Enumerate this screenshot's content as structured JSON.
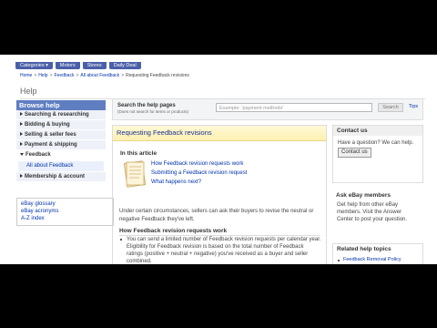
{
  "nav": {
    "tabs": [
      "Categories ▾",
      "Motors",
      "Stores",
      "Daily Deal"
    ]
  },
  "breadcrumb": [
    "Home",
    "Help",
    "Feedback",
    "All about Feedback",
    "Requesting Feedback revisions"
  ],
  "page_title": "Help",
  "sidebar": {
    "title": "Browse help",
    "items": [
      {
        "label": "Searching & researching"
      },
      {
        "label": "Bidding & buying"
      },
      {
        "label": "Selling & seller fees"
      },
      {
        "label": "Payment & shipping"
      },
      {
        "label": "Feedback"
      },
      {
        "label": "Membership & account"
      }
    ],
    "sub_item": "All about Feedback",
    "links": [
      "eBay glossary",
      "eBay acronyms",
      "A-Z index"
    ]
  },
  "search": {
    "label": "Search the help pages",
    "sublabel": "(Does not search for items or products)",
    "placeholder": "Example: 'payment methods'",
    "button": "Search",
    "tips": "Tips"
  },
  "article": {
    "title": "Requesting Feedback revisions",
    "in_this_article": "In this article",
    "toc": [
      "How Feedback revision requests work",
      "Submitting a Feedback revision request",
      "What happens next?"
    ],
    "intro": "Under certain circumstances, sellers can ask their buyers to revise the neutral or negative Feedback they've left.",
    "section_title": "How Feedback revision requests work",
    "bullet": "You can send a limited number of Feedback revision requests per calendar year. Eligibility for Feedback revision is based on the total number of Feedback ratings (positive + neutral + negative) you've received as a buyer and seller combined."
  },
  "contact": {
    "title": "Contact us",
    "text": "Have a question? We can help.",
    "button": "Contact us"
  },
  "members": {
    "title": "Ask eBay members",
    "text": "Get help from other eBay members. Visit the Answer Center to post your question."
  },
  "related": {
    "title": "Related help topics",
    "link": "Feedback Removal Policy"
  }
}
